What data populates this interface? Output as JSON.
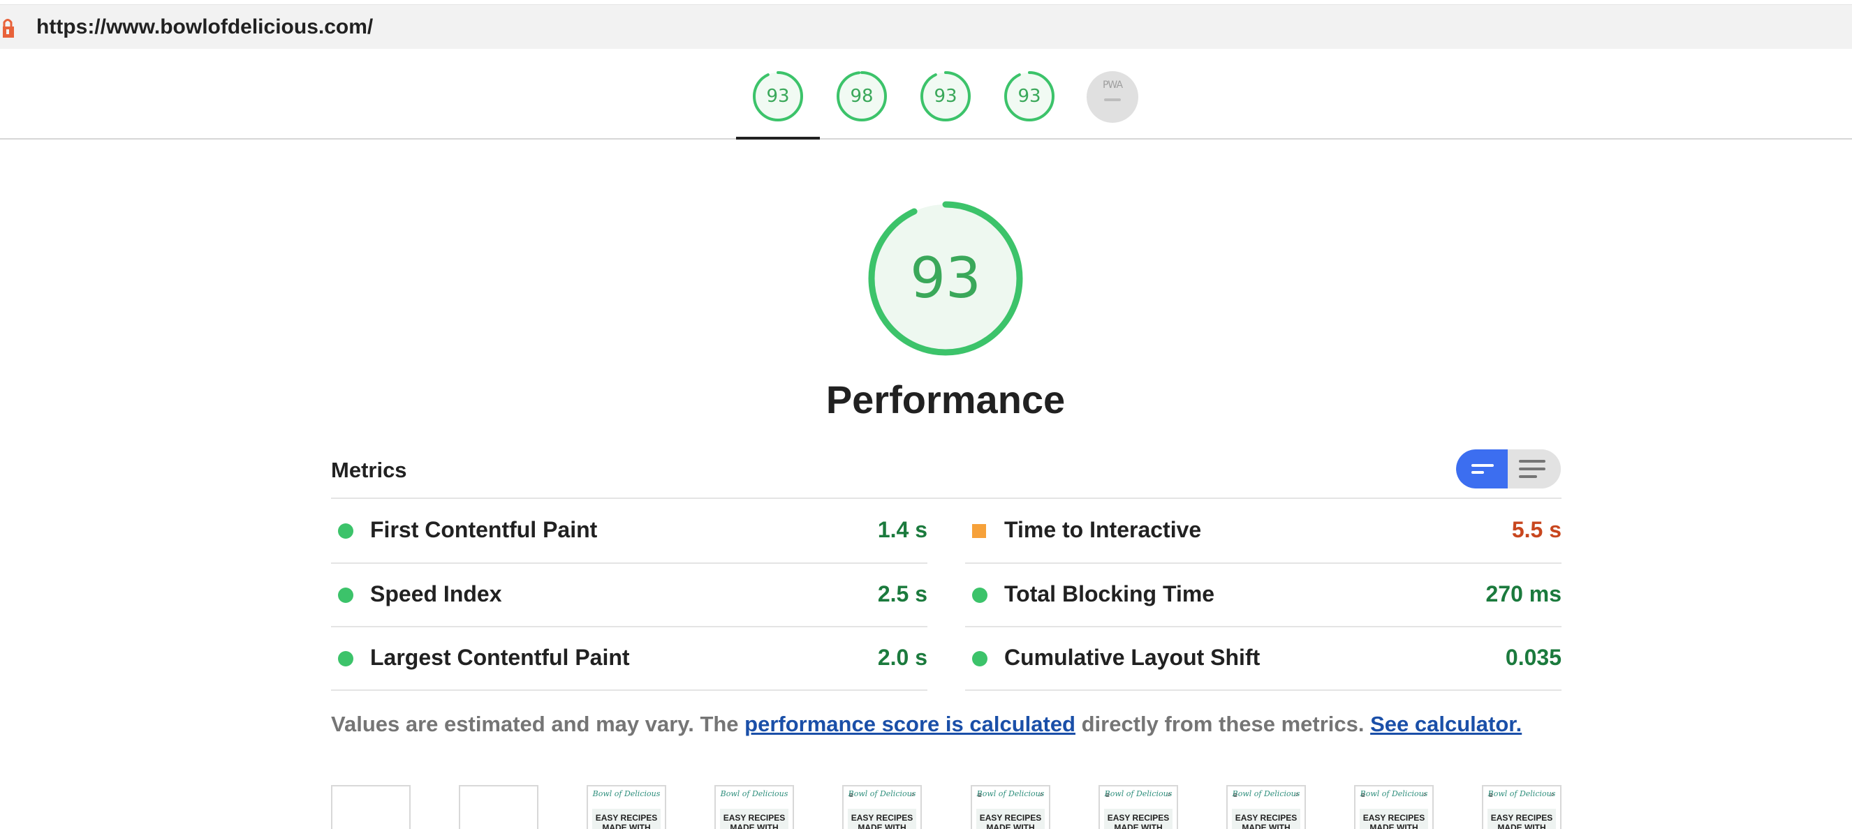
{
  "urlbar": {
    "url": "https://www.bowlofdelicious.com/",
    "lock_icon": "lighthouse-icon"
  },
  "score_tabs": [
    {
      "score": "93",
      "fraction": 0.93
    },
    {
      "score": "98",
      "fraction": 0.98
    },
    {
      "score": "93",
      "fraction": 0.93
    },
    {
      "score": "93",
      "fraction": 0.93
    }
  ],
  "pwa_badge": {
    "label": "PWA"
  },
  "colors": {
    "pass": "#3cc36a",
    "pass_text": "#1b7a3d",
    "average": "#f6a13a",
    "fail_text": "#c8461e",
    "accent": "#3c6ef0",
    "link": "#1a4fa8"
  },
  "gauge": {
    "score": "93",
    "fraction": 0.93,
    "title": "Performance"
  },
  "metrics": {
    "heading": "Metrics",
    "toggle_icons": [
      "bar-view-icon",
      "list-view-icon"
    ],
    "left": [
      {
        "name": "First Contentful Paint",
        "value": "1.4 s",
        "status": "pass"
      },
      {
        "name": "Speed Index",
        "value": "2.5 s",
        "status": "pass"
      },
      {
        "name": "Largest Contentful Paint",
        "value": "2.0 s",
        "status": "pass"
      }
    ],
    "right": [
      {
        "name": "Time to Interactive",
        "value": "5.5 s",
        "status": "average"
      },
      {
        "name": "Total Blocking Time",
        "value": "270 ms",
        "status": "pass"
      },
      {
        "name": "Cumulative Layout Shift",
        "value": "0.035",
        "status": "pass"
      }
    ]
  },
  "note": {
    "prefix": "Values are estimated and may vary. The ",
    "link1": "performance score is calculated",
    "middle": " directly from these metrics. ",
    "link2": "See calculator."
  },
  "filmstrip": {
    "logo": "Bowl of Delicious",
    "headline": "EASY RECIPES MADE WITH",
    "frames": [
      "blank",
      "blank",
      "loaded",
      "loaded",
      "loaded",
      "loaded",
      "loaded",
      "loaded",
      "loaded",
      "loaded"
    ]
  }
}
